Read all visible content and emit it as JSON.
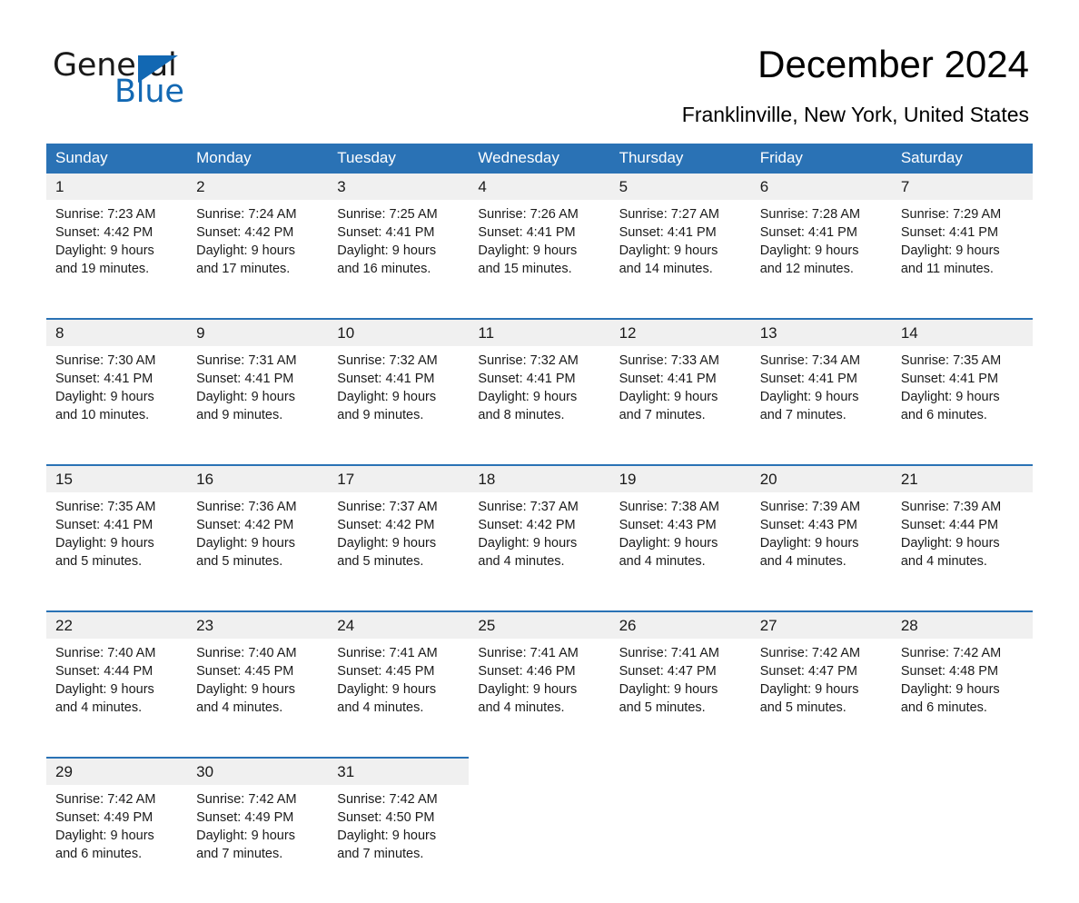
{
  "brand": {
    "word_one": "General",
    "word_two": "Blue",
    "triangle_icon": "triangle-icon",
    "accent_color": "#1268b3"
  },
  "header": {
    "title": "December 2024",
    "location": "Franklinville, New York, United States"
  },
  "theme": {
    "header_blue": "#2a72b5",
    "daynum_gray": "#f0f0f0",
    "text": "#1a1a1a"
  },
  "weekdays": [
    "Sunday",
    "Monday",
    "Tuesday",
    "Wednesday",
    "Thursday",
    "Friday",
    "Saturday"
  ],
  "weeks": [
    [
      {
        "day": "1",
        "sunrise": "Sunrise: 7:23 AM",
        "sunset": "Sunset: 4:42 PM",
        "daylight_1": "Daylight: 9 hours",
        "daylight_2": "and 19 minutes."
      },
      {
        "day": "2",
        "sunrise": "Sunrise: 7:24 AM",
        "sunset": "Sunset: 4:42 PM",
        "daylight_1": "Daylight: 9 hours",
        "daylight_2": "and 17 minutes."
      },
      {
        "day": "3",
        "sunrise": "Sunrise: 7:25 AM",
        "sunset": "Sunset: 4:41 PM",
        "daylight_1": "Daylight: 9 hours",
        "daylight_2": "and 16 minutes."
      },
      {
        "day": "4",
        "sunrise": "Sunrise: 7:26 AM",
        "sunset": "Sunset: 4:41 PM",
        "daylight_1": "Daylight: 9 hours",
        "daylight_2": "and 15 minutes."
      },
      {
        "day": "5",
        "sunrise": "Sunrise: 7:27 AM",
        "sunset": "Sunset: 4:41 PM",
        "daylight_1": "Daylight: 9 hours",
        "daylight_2": "and 14 minutes."
      },
      {
        "day": "6",
        "sunrise": "Sunrise: 7:28 AM",
        "sunset": "Sunset: 4:41 PM",
        "daylight_1": "Daylight: 9 hours",
        "daylight_2": "and 12 minutes."
      },
      {
        "day": "7",
        "sunrise": "Sunrise: 7:29 AM",
        "sunset": "Sunset: 4:41 PM",
        "daylight_1": "Daylight: 9 hours",
        "daylight_2": "and 11 minutes."
      }
    ],
    [
      {
        "day": "8",
        "sunrise": "Sunrise: 7:30 AM",
        "sunset": "Sunset: 4:41 PM",
        "daylight_1": "Daylight: 9 hours",
        "daylight_2": "and 10 minutes."
      },
      {
        "day": "9",
        "sunrise": "Sunrise: 7:31 AM",
        "sunset": "Sunset: 4:41 PM",
        "daylight_1": "Daylight: 9 hours",
        "daylight_2": "and 9 minutes."
      },
      {
        "day": "10",
        "sunrise": "Sunrise: 7:32 AM",
        "sunset": "Sunset: 4:41 PM",
        "daylight_1": "Daylight: 9 hours",
        "daylight_2": "and 9 minutes."
      },
      {
        "day": "11",
        "sunrise": "Sunrise: 7:32 AM",
        "sunset": "Sunset: 4:41 PM",
        "daylight_1": "Daylight: 9 hours",
        "daylight_2": "and 8 minutes."
      },
      {
        "day": "12",
        "sunrise": "Sunrise: 7:33 AM",
        "sunset": "Sunset: 4:41 PM",
        "daylight_1": "Daylight: 9 hours",
        "daylight_2": "and 7 minutes."
      },
      {
        "day": "13",
        "sunrise": "Sunrise: 7:34 AM",
        "sunset": "Sunset: 4:41 PM",
        "daylight_1": "Daylight: 9 hours",
        "daylight_2": "and 7 minutes."
      },
      {
        "day": "14",
        "sunrise": "Sunrise: 7:35 AM",
        "sunset": "Sunset: 4:41 PM",
        "daylight_1": "Daylight: 9 hours",
        "daylight_2": "and 6 minutes."
      }
    ],
    [
      {
        "day": "15",
        "sunrise": "Sunrise: 7:35 AM",
        "sunset": "Sunset: 4:41 PM",
        "daylight_1": "Daylight: 9 hours",
        "daylight_2": "and 5 minutes."
      },
      {
        "day": "16",
        "sunrise": "Sunrise: 7:36 AM",
        "sunset": "Sunset: 4:42 PM",
        "daylight_1": "Daylight: 9 hours",
        "daylight_2": "and 5 minutes."
      },
      {
        "day": "17",
        "sunrise": "Sunrise: 7:37 AM",
        "sunset": "Sunset: 4:42 PM",
        "daylight_1": "Daylight: 9 hours",
        "daylight_2": "and 5 minutes."
      },
      {
        "day": "18",
        "sunrise": "Sunrise: 7:37 AM",
        "sunset": "Sunset: 4:42 PM",
        "daylight_1": "Daylight: 9 hours",
        "daylight_2": "and 4 minutes."
      },
      {
        "day": "19",
        "sunrise": "Sunrise: 7:38 AM",
        "sunset": "Sunset: 4:43 PM",
        "daylight_1": "Daylight: 9 hours",
        "daylight_2": "and 4 minutes."
      },
      {
        "day": "20",
        "sunrise": "Sunrise: 7:39 AM",
        "sunset": "Sunset: 4:43 PM",
        "daylight_1": "Daylight: 9 hours",
        "daylight_2": "and 4 minutes."
      },
      {
        "day": "21",
        "sunrise": "Sunrise: 7:39 AM",
        "sunset": "Sunset: 4:44 PM",
        "daylight_1": "Daylight: 9 hours",
        "daylight_2": "and 4 minutes."
      }
    ],
    [
      {
        "day": "22",
        "sunrise": "Sunrise: 7:40 AM",
        "sunset": "Sunset: 4:44 PM",
        "daylight_1": "Daylight: 9 hours",
        "daylight_2": "and 4 minutes."
      },
      {
        "day": "23",
        "sunrise": "Sunrise: 7:40 AM",
        "sunset": "Sunset: 4:45 PM",
        "daylight_1": "Daylight: 9 hours",
        "daylight_2": "and 4 minutes."
      },
      {
        "day": "24",
        "sunrise": "Sunrise: 7:41 AM",
        "sunset": "Sunset: 4:45 PM",
        "daylight_1": "Daylight: 9 hours",
        "daylight_2": "and 4 minutes."
      },
      {
        "day": "25",
        "sunrise": "Sunrise: 7:41 AM",
        "sunset": "Sunset: 4:46 PM",
        "daylight_1": "Daylight: 9 hours",
        "daylight_2": "and 4 minutes."
      },
      {
        "day": "26",
        "sunrise": "Sunrise: 7:41 AM",
        "sunset": "Sunset: 4:47 PM",
        "daylight_1": "Daylight: 9 hours",
        "daylight_2": "and 5 minutes."
      },
      {
        "day": "27",
        "sunrise": "Sunrise: 7:42 AM",
        "sunset": "Sunset: 4:47 PM",
        "daylight_1": "Daylight: 9 hours",
        "daylight_2": "and 5 minutes."
      },
      {
        "day": "28",
        "sunrise": "Sunrise: 7:42 AM",
        "sunset": "Sunset: 4:48 PM",
        "daylight_1": "Daylight: 9 hours",
        "daylight_2": "and 6 minutes."
      }
    ],
    [
      {
        "day": "29",
        "sunrise": "Sunrise: 7:42 AM",
        "sunset": "Sunset: 4:49 PM",
        "daylight_1": "Daylight: 9 hours",
        "daylight_2": "and 6 minutes."
      },
      {
        "day": "30",
        "sunrise": "Sunrise: 7:42 AM",
        "sunset": "Sunset: 4:49 PM",
        "daylight_1": "Daylight: 9 hours",
        "daylight_2": "and 7 minutes."
      },
      {
        "day": "31",
        "sunrise": "Sunrise: 7:42 AM",
        "sunset": "Sunset: 4:50 PM",
        "daylight_1": "Daylight: 9 hours",
        "daylight_2": "and 7 minutes."
      },
      {
        "day": "",
        "sunrise": "",
        "sunset": "",
        "daylight_1": "",
        "daylight_2": ""
      },
      {
        "day": "",
        "sunrise": "",
        "sunset": "",
        "daylight_1": "",
        "daylight_2": ""
      },
      {
        "day": "",
        "sunrise": "",
        "sunset": "",
        "daylight_1": "",
        "daylight_2": ""
      },
      {
        "day": "",
        "sunrise": "",
        "sunset": "",
        "daylight_1": "",
        "daylight_2": ""
      }
    ]
  ]
}
